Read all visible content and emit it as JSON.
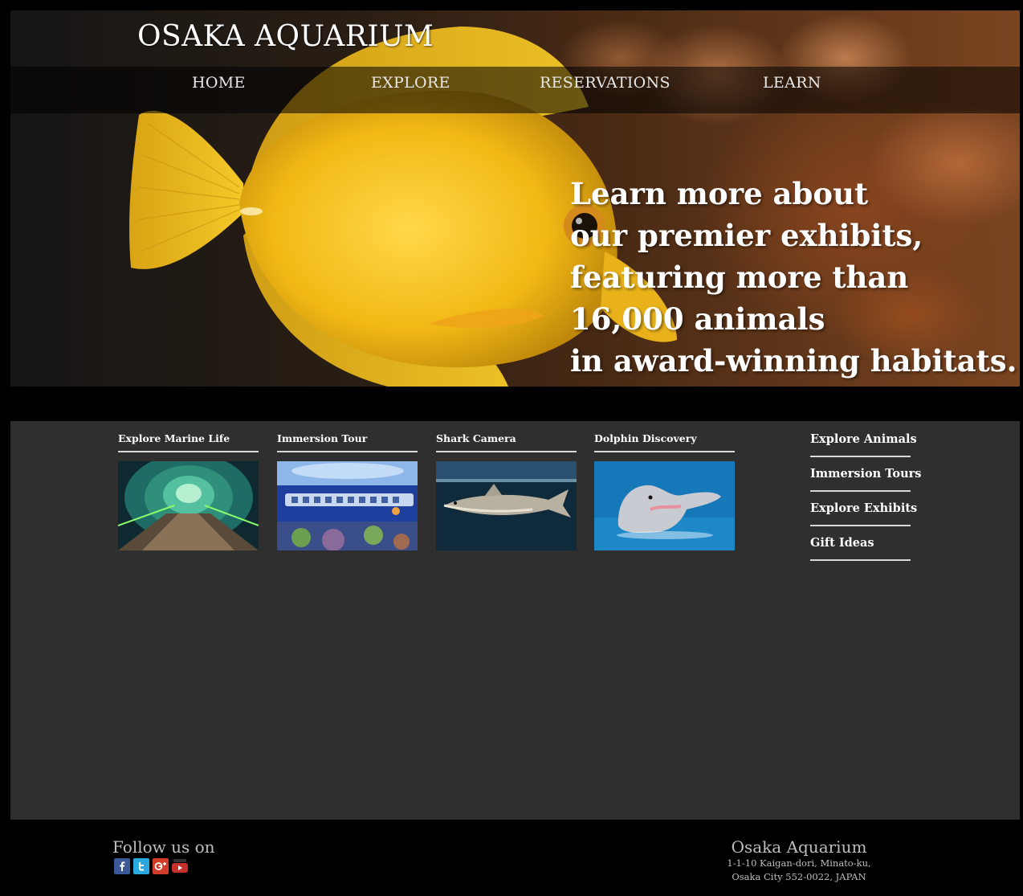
{
  "site": {
    "title": "OSAKA AQUARIUM"
  },
  "nav": {
    "items": [
      {
        "label": "HOME"
      },
      {
        "label": "EXPLORE"
      },
      {
        "label": "RESERVATIONS"
      },
      {
        "label": "LEARN"
      }
    ]
  },
  "hero": {
    "lines": [
      "Learn more about",
      "our premier exhibits,",
      "featuring more than",
      "16,000 animals",
      "in award-winning habitats."
    ]
  },
  "cards": [
    {
      "title": "Explore Marine Life",
      "image_icon": "tunnel-image"
    },
    {
      "title": "Immersion Tour",
      "image_icon": "submarine-image"
    },
    {
      "title": "Shark Camera",
      "image_icon": "shark-image"
    },
    {
      "title": "Dolphin Discovery",
      "image_icon": "dolphin-image"
    }
  ],
  "side_links": [
    {
      "label": "Explore Animals"
    },
    {
      "label": "Immersion Tours"
    },
    {
      "label": "Explore Exhibits"
    },
    {
      "label": "Gift Ideas"
    }
  ],
  "footer": {
    "follow_label": "Follow us on",
    "social": [
      {
        "icon": "facebook-icon",
        "color": "#3b5998"
      },
      {
        "icon": "twitter-icon",
        "color": "#2aa9e0"
      },
      {
        "icon": "google-plus-icon",
        "color": "#d23c2a"
      },
      {
        "icon": "youtube-icon",
        "color": "#c4302b"
      }
    ],
    "org_name": "Osaka Aquarium",
    "address_line1": "1-1-10 Kaigan-dori, Minato-ku,",
    "address_line2": "Osaka City 552-0022, JAPAN"
  },
  "colors": {
    "page_bg": "#000000",
    "content_bg": "#2f2f2f",
    "fish_yellow": "#f2c21b"
  }
}
